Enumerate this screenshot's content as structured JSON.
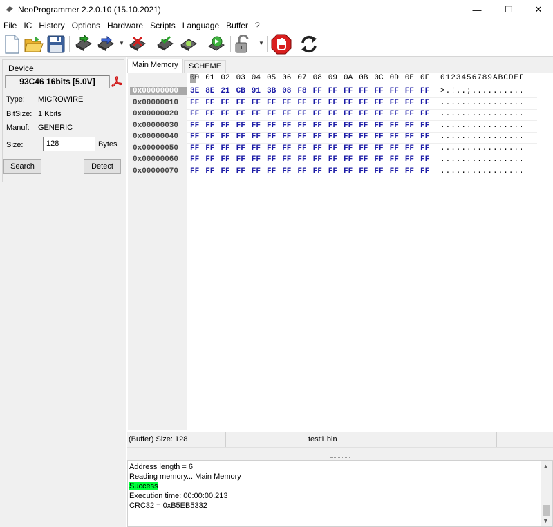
{
  "window": {
    "title": "NeoProgrammer 2.2.0.10 (15.10.2021)",
    "minimize": "—",
    "maximize": "☐",
    "close": "✕"
  },
  "menu": [
    "File",
    "IC",
    "History",
    "Options",
    "Hardware",
    "Scripts",
    "Language",
    "Buffer",
    "?"
  ],
  "toolbar": {
    "icons": [
      "new-file-icon",
      "open-folder-icon",
      "save-floppy-icon",
      "read-chip-icon",
      "write-chip-icon",
      "erase-chip-icon",
      "verify-chip-icon",
      "blank-check-icon",
      "auto-chip-icon",
      "lock-icon",
      "stop-icon",
      "refresh-icon"
    ]
  },
  "device": {
    "title": "Device",
    "name": "93C46 16bits [5.0V]",
    "type_label": "Type:",
    "type_value": "MICROWIRE",
    "bitsize_label": "BitSize:",
    "bitsize_value": "1 Kbits",
    "manuf_label": "Manuf:",
    "manuf_value": "GENERIC",
    "size_label": "Size:",
    "size_value": "128",
    "bytes_label": "Bytes",
    "search_button": "Search",
    "detect_button": "Detect"
  },
  "tabs": [
    "Main Memory",
    "SCHEME"
  ],
  "hex": {
    "column_headers": [
      "00",
      "01",
      "02",
      "03",
      "04",
      "05",
      "06",
      "07",
      "08",
      "09",
      "0A",
      "0B",
      "0C",
      "0D",
      "0E",
      "0F"
    ],
    "ascii_header": "0123456789ABCDEF",
    "rows": [
      {
        "addr": "0x00000000",
        "bytes": [
          "3E",
          "8E",
          "21",
          "CB",
          "91",
          "3B",
          "08",
          "F8",
          "FF",
          "FF",
          "FF",
          "FF",
          "FF",
          "FF",
          "FF",
          "FF"
        ],
        "ascii": ">.!..;.........."
      },
      {
        "addr": "0x00000010",
        "bytes": [
          "FF",
          "FF",
          "FF",
          "FF",
          "FF",
          "FF",
          "FF",
          "FF",
          "FF",
          "FF",
          "FF",
          "FF",
          "FF",
          "FF",
          "FF",
          "FF"
        ],
        "ascii": "................"
      },
      {
        "addr": "0x00000020",
        "bytes": [
          "FF",
          "FF",
          "FF",
          "FF",
          "FF",
          "FF",
          "FF",
          "FF",
          "FF",
          "FF",
          "FF",
          "FF",
          "FF",
          "FF",
          "FF",
          "FF"
        ],
        "ascii": "................"
      },
      {
        "addr": "0x00000030",
        "bytes": [
          "FF",
          "FF",
          "FF",
          "FF",
          "FF",
          "FF",
          "FF",
          "FF",
          "FF",
          "FF",
          "FF",
          "FF",
          "FF",
          "FF",
          "FF",
          "FF"
        ],
        "ascii": "................"
      },
      {
        "addr": "0x00000040",
        "bytes": [
          "FF",
          "FF",
          "FF",
          "FF",
          "FF",
          "FF",
          "FF",
          "FF",
          "FF",
          "FF",
          "FF",
          "FF",
          "FF",
          "FF",
          "FF",
          "FF"
        ],
        "ascii": "................"
      },
      {
        "addr": "0x00000050",
        "bytes": [
          "FF",
          "FF",
          "FF",
          "FF",
          "FF",
          "FF",
          "FF",
          "FF",
          "FF",
          "FF",
          "FF",
          "FF",
          "FF",
          "FF",
          "FF",
          "FF"
        ],
        "ascii": "................"
      },
      {
        "addr": "0x00000060",
        "bytes": [
          "FF",
          "FF",
          "FF",
          "FF",
          "FF",
          "FF",
          "FF",
          "FF",
          "FF",
          "FF",
          "FF",
          "FF",
          "FF",
          "FF",
          "FF",
          "FF"
        ],
        "ascii": "................"
      },
      {
        "addr": "0x00000070",
        "bytes": [
          "FF",
          "FF",
          "FF",
          "FF",
          "FF",
          "FF",
          "FF",
          "FF",
          "FF",
          "FF",
          "FF",
          "FF",
          "FF",
          "FF",
          "FF",
          "FF"
        ],
        "ascii": "................"
      }
    ]
  },
  "status": {
    "buffer_size": "(Buffer) Size: 128",
    "file_name": "test1.bin"
  },
  "log": [
    {
      "text": "Address length = 6",
      "highlight": false
    },
    {
      "text": "Reading memory... Main Memory",
      "highlight": false
    },
    {
      "text": "Success",
      "highlight": true
    },
    {
      "text": "Execution time: 00:00:00.213",
      "highlight": false
    },
    {
      "text": "CRC32 = 0xB5EB5332",
      "highlight": false
    }
  ],
  "colors": {
    "hex_bytes": "#1a1aa6",
    "success_highlight": "#00ff3a",
    "selected_address": "#a9a9a9"
  }
}
